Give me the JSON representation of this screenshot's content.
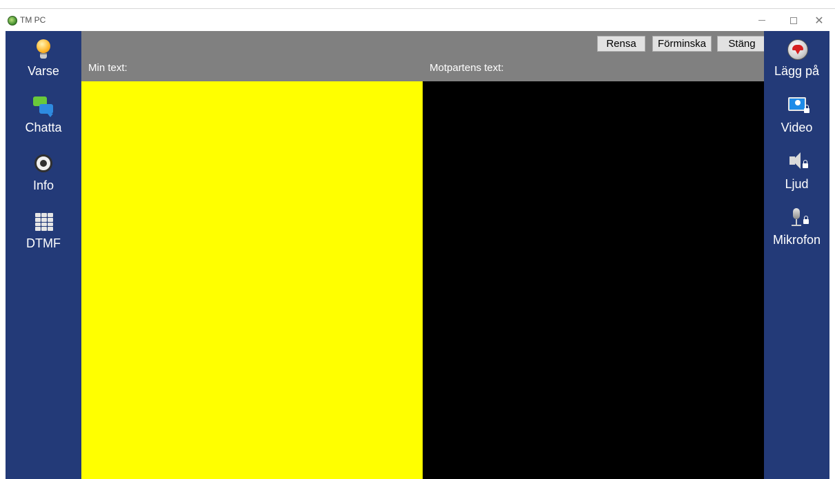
{
  "window": {
    "title": "TM PC",
    "minimize_glyph": "–",
    "maximize_glyph": "□",
    "close_glyph": "✕"
  },
  "sidebar_left": {
    "items": [
      {
        "label": "Varse",
        "icon": "lightbulb-icon"
      },
      {
        "label": "Chatta",
        "icon": "chat-icon"
      },
      {
        "label": "Info",
        "icon": "info-icon"
      },
      {
        "label": "DTMF",
        "icon": "keypad-icon"
      }
    ]
  },
  "sidebar_right": {
    "items": [
      {
        "label": "Lägg på",
        "icon": "hang-up-icon"
      },
      {
        "label": "Video",
        "icon": "video-locked-icon"
      },
      {
        "label": "Ljud",
        "icon": "speaker-locked-icon"
      },
      {
        "label": "Mikrofon",
        "icon": "microphone-locked-icon"
      }
    ]
  },
  "toolbar": {
    "clear_label": "Rensa",
    "minimize_label": "Förminska",
    "close_label": "Stäng"
  },
  "panes": {
    "mine_label": "Min text:",
    "other_label": "Motpartens text:",
    "mine_value": "",
    "other_value": ""
  },
  "colors": {
    "sidebar": "#233a78",
    "toolbar": "#808080",
    "mine_background": "#ffff00",
    "other_background": "#000000"
  }
}
